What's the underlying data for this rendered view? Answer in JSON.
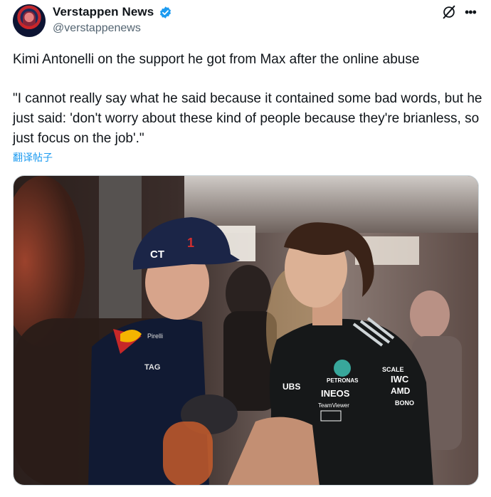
{
  "author": {
    "name": "Verstappen News",
    "handle": "@verstappenews",
    "verified": true,
    "avatar_icon": "driver-helmet-avatar"
  },
  "post": {
    "paragraphs": [
      "Kimi Antonelli on the support he got from Max after the online abuse",
      "\"I cannot really say what he said because it contained some bad words, but he just said: 'don't worry about these kind of people because they're brianless, so just focus on the job'.\""
    ],
    "translate_label": "翻译帖子"
  },
  "header_actions": {
    "grok_icon": "grok-icon",
    "more_icon": "more-options-icon"
  },
  "colors": {
    "link": "#1d9bf0",
    "verified": "#1d9bf0",
    "muted": "#536471"
  },
  "media": {
    "type": "photo",
    "cap_left": "CT",
    "cap_number": "1",
    "shirt_brand_1": "PETRONAS",
    "shirt_brand_2": "INEOS",
    "shirt_brand_3": "UBS",
    "shirt_brand_4": "IWC",
    "shirt_brand_5": "AMD",
    "shirt_brand_6": "SCALE",
    "shirt_brand_7": "TeamViewer",
    "shirt_brand_8": "BONO",
    "rb_brand_1": "TAG",
    "rb_brand_2": "Pirelli"
  }
}
